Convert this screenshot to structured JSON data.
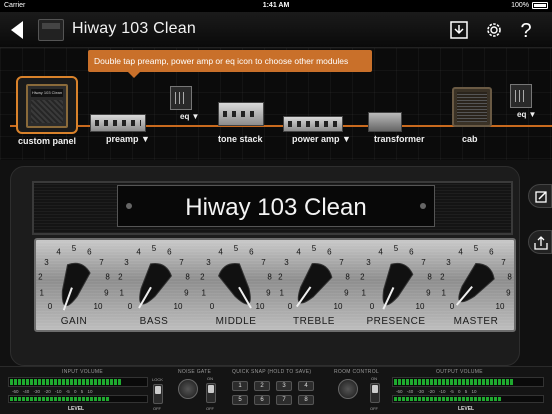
{
  "status_bar": {
    "carrier": "Carrier",
    "time": "1:41 AM",
    "battery": "100%"
  },
  "header": {
    "title": "Hiway 103 Clean"
  },
  "tooltip": {
    "text": "Double tap preamp, power amp or eq icon to choose other modules"
  },
  "chain": {
    "custom_panel": "custom panel",
    "custom_badge": "Hiway 103 Clean",
    "preamp": "preamp ▼",
    "eq1": "eq ▼",
    "tone_stack": "tone stack",
    "power_amp": "power amp ▼",
    "transformer": "transformer",
    "cab": "cab",
    "eq2": "eq ▼"
  },
  "amp": {
    "name": "Hiway 103 Clean",
    "knobs": [
      {
        "label": "GAIN"
      },
      {
        "label": "BASS"
      },
      {
        "label": "MIDDLE"
      },
      {
        "label": "TREBLE"
      },
      {
        "label": "PRESENCE"
      },
      {
        "label": "MASTER"
      }
    ],
    "scale_numbers": [
      "0",
      "1",
      "2",
      "3",
      "4",
      "5",
      "6",
      "7",
      "8",
      "9",
      "10"
    ]
  },
  "bottom": {
    "input_volume": "INPUT VOLUME",
    "input_scale": "-60 -40 -30 -20 -10 -5 0 5 10",
    "input_level": "LEVEL",
    "lock": "LOCK",
    "off": "OFF",
    "noise_gate": "NOISE GATE",
    "ng_on": "ON",
    "ng_off": "OFF",
    "quick_snap": "QUICK SNAP (HOLD TO SAVE)",
    "snaps": [
      "1",
      "2",
      "3",
      "4",
      "5",
      "6",
      "7",
      "8"
    ],
    "room_control": "ROOM CONTROL",
    "rc_on": "ON",
    "rc_off": "OFF",
    "output_volume": "OUTPUT VOLUME",
    "output_scale": "-60 -40 -30 -20 -10 -5 0 5 10",
    "output_level": "LEVEL"
  },
  "colors": {
    "accent": "#c96a1e",
    "meter_green": "#1faa2f"
  }
}
